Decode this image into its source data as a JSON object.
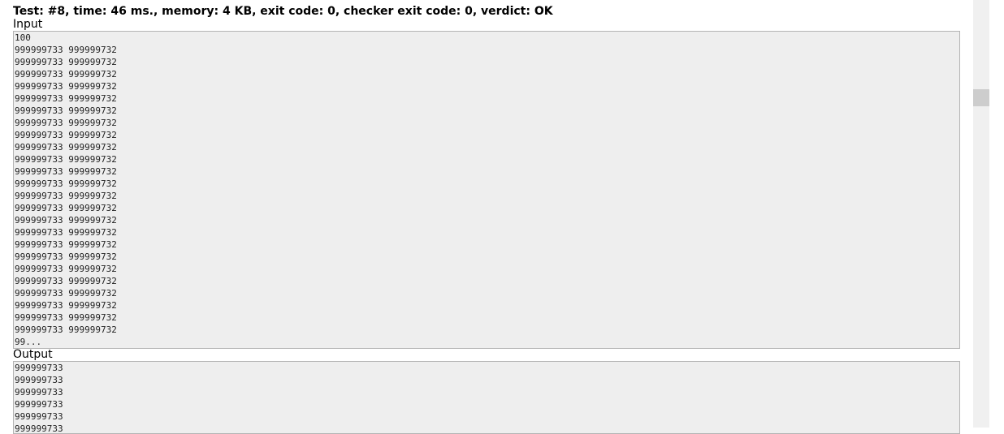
{
  "header": "Test: #8, time: 46 ms., memory: 4 KB, exit code: 0, checker exit code: 0, verdict: OK",
  "input": {
    "label": "Input",
    "lines": [
      "100",
      "999999733 999999732",
      "999999733 999999732",
      "999999733 999999732",
      "999999733 999999732",
      "999999733 999999732",
      "999999733 999999732",
      "999999733 999999732",
      "999999733 999999732",
      "999999733 999999732",
      "999999733 999999732",
      "999999733 999999732",
      "999999733 999999732",
      "999999733 999999732",
      "999999733 999999732",
      "999999733 999999732",
      "999999733 999999732",
      "999999733 999999732",
      "999999733 999999732",
      "999999733 999999732",
      "999999733 999999732",
      "999999733 999999732",
      "999999733 999999732",
      "999999733 999999732",
      "999999733 999999732",
      "99..."
    ]
  },
  "output": {
    "label": "Output",
    "lines": [
      "999999733",
      "999999733",
      "999999733",
      "999999733",
      "999999733",
      "999999733"
    ]
  }
}
